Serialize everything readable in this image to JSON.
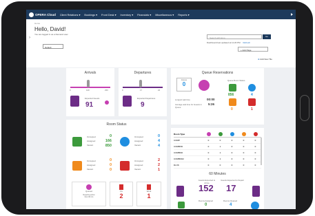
{
  "nav": {
    "logo": "OPERA Cloud",
    "items": [
      "Client Relations ▾",
      "Bookings ▾",
      "Front Desk ▾",
      "Inventory ▾",
      "Financials ▾",
      "Miscellaneous ▾",
      "Reports ▾"
    ]
  },
  "header": {
    "crumb": "Home",
    "greeting": "Hello, David!",
    "subtitle": "You are logged in as a Demand user.",
    "select": "Default",
    "search_placeholder": "Search with Emp",
    "go": "Go",
    "updated": "Dashboard last updated at 11:20 PM",
    "refresh": "Refresh",
    "add_page": "+ Add Page",
    "add_tile": "Add New Tile"
  },
  "arrivals": {
    "title": "Arrivals",
    "left": "0",
    "mid": "140",
    "right": "233",
    "expected_label": "Expected Guests",
    "expected": "91"
  },
  "departures": {
    "title": "Departures",
    "left": "0",
    "mid": "17",
    "right": "24",
    "expected_label": "Expected Departures",
    "expected": "9"
  },
  "queue": {
    "title": "Queue Reservations",
    "queue_label": "Queue",
    "queue_value": "0",
    "status_label": "Queue Room Status",
    "val1": "856",
    "val2": "4",
    "val3": "0",
    "val4": "1",
    "avg_label": "Longest wait time",
    "avg_value": "00:00",
    "time_label": "Average wait time for Guests in Queue",
    "time_value": "5:26"
  },
  "roomtype": {
    "header": "Room Type",
    "rows": [
      {
        "type": "COMP",
        "v": [
          "0",
          "0",
          "2",
          "0",
          "0"
        ]
      },
      {
        "type": "COMBXD",
        "v": [
          "0",
          "1",
          "0",
          "0",
          "0"
        ]
      },
      {
        "type": "COMBKD",
        "v": [
          "0",
          "1",
          "0",
          "0",
          "0"
        ]
      },
      {
        "type": "COMBKD2",
        "v": [
          "0",
          "1",
          "0",
          "0",
          "0"
        ]
      },
      {
        "type": "DLXK",
        "v": [
          "0",
          "0",
          "0",
          "0",
          "0"
        ]
      }
    ]
  },
  "roomstatus": {
    "title": "Room Status",
    "clean": {
      "a": "Occupied",
      "av": "0",
      "b": "Assigned",
      "bv": "166",
      "c": "Vacant",
      "cv": "850"
    },
    "inspected": {
      "a": "Occupied",
      "av": "0",
      "b": "Assigned",
      "bv": "4",
      "c": "Vacant",
      "cv": "4"
    },
    "dirty": {
      "a": "Occupied",
      "av": "0",
      "b": "Assigned",
      "bv": "0",
      "c": "Vacant",
      "cv": "0"
    },
    "ooo": {
      "a": "Occupied",
      "av": "2",
      "b": "Assigned",
      "bv": "2",
      "c": "Vacant",
      "cv": "1"
    },
    "b1_label": "Queued",
    "b1_sub": "Requiring action\nNext 30 min",
    "b2_label": "Fix",
    "b2_value": "2",
    "b3_label": "Work",
    "b3_value": "1"
  },
  "sixty": {
    "title": "60 Minutes",
    "arr_label": "Guests Expected to Arrive",
    "arr_value": "152",
    "dep_label": "Guests Expected to Depart",
    "dep_value": "17",
    "r1_label": "Rooms Assigned",
    "r1_value": "0",
    "r2_label": "Rooms Cleaned",
    "r2_value": "4"
  },
  "colors": {
    "navy": "#1d3a5c",
    "green": "#3c9a3c",
    "blue": "#1f8ee0",
    "magenta": "#c63fb1",
    "purple": "#6c2c86",
    "orange": "#f08a1c",
    "red": "#d42c2c"
  }
}
